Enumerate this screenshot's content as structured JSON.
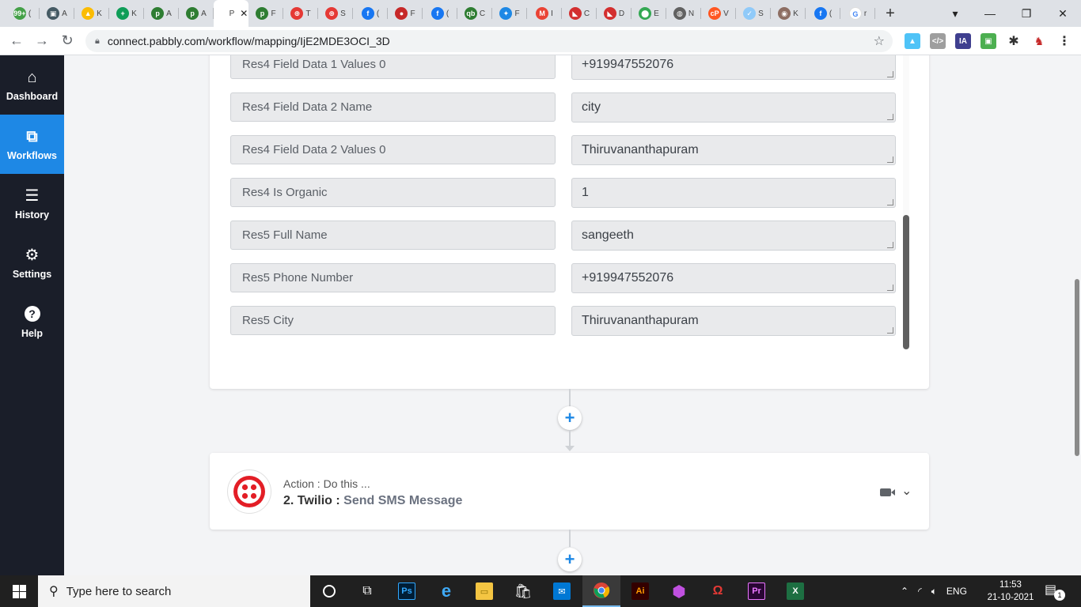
{
  "browser": {
    "tabs": [
      {
        "label": "(",
        "color": "#43a047",
        "glyph": "99+"
      },
      {
        "label": "A",
        "color": "#455a64",
        "glyph": "▣"
      },
      {
        "label": "K",
        "color": "#fbbc04",
        "glyph": "▲"
      },
      {
        "label": "K",
        "color": "#0f9d58",
        "glyph": "+"
      },
      {
        "label": "A",
        "color": "#2e7d32",
        "glyph": "p"
      },
      {
        "label": "A",
        "color": "#2e7d32",
        "glyph": "p"
      },
      {
        "label": "P",
        "color": "#ffffff",
        "glyph": "",
        "active": true
      },
      {
        "label": "F",
        "color": "#2e7d32",
        "glyph": "p"
      },
      {
        "label": "T",
        "color": "#e53935",
        "glyph": "⊕"
      },
      {
        "label": "S",
        "color": "#e53935",
        "glyph": "⊕"
      },
      {
        "label": "(",
        "color": "#1877f2",
        "glyph": "f"
      },
      {
        "label": "F",
        "color": "#c62828",
        "glyph": "●"
      },
      {
        "label": "(",
        "color": "#1877f2",
        "glyph": "f"
      },
      {
        "label": "C",
        "color": "#2e7d32",
        "glyph": "qb"
      },
      {
        "label": "F",
        "color": "#1e88e5",
        "glyph": "✦"
      },
      {
        "label": "I",
        "color": "#ea4335",
        "glyph": "M"
      },
      {
        "label": "C",
        "color": "#d32f2f",
        "glyph": "◣"
      },
      {
        "label": "D",
        "color": "#d32f2f",
        "glyph": "◣"
      },
      {
        "label": "E",
        "color": "#34a853",
        "glyph": "⬤"
      },
      {
        "label": "N",
        "color": "#616161",
        "glyph": "◍"
      },
      {
        "label": "V",
        "color": "#ff5722",
        "glyph": "cP"
      },
      {
        "label": "S",
        "color": "#90caf9",
        "glyph": "✓"
      },
      {
        "label": "K",
        "color": "#8d6e63",
        "glyph": "◉"
      },
      {
        "label": "(",
        "color": "#1877f2",
        "glyph": "f"
      },
      {
        "label": "r",
        "color": "#ffffff",
        "glyph": "G"
      }
    ],
    "active_tab_label": "P",
    "close_glyph": "✕",
    "new_tab_glyph": "+",
    "url": "connect.pabbly.com/workflow/mapping/IjE2MDE3OCI_3D"
  },
  "sidebar": {
    "items": [
      {
        "label": "Dashboard",
        "icon": "home-icon",
        "glyph": "⌂"
      },
      {
        "label": "Workflows",
        "icon": "workflow-icon",
        "glyph": "⧉",
        "active": true
      },
      {
        "label": "History",
        "icon": "history-list-icon",
        "glyph": "☰"
      },
      {
        "label": "Settings",
        "icon": "gear-icon",
        "glyph": "⚙"
      },
      {
        "label": "Help",
        "icon": "help-icon",
        "glyph": "?"
      }
    ]
  },
  "mapping": {
    "rows": [
      {
        "key": "Res4 Field Data 1 Values 0",
        "value": "+919947552076"
      },
      {
        "key": "Res4 Field Data 2 Name",
        "value": "city"
      },
      {
        "key": "Res4 Field Data 2 Values 0",
        "value": "Thiruvananthapuram"
      },
      {
        "key": "Res4 Is Organic",
        "value": "1"
      },
      {
        "key": "Res5 Full Name",
        "value": "sangeeth"
      },
      {
        "key": "Res5 Phone Number",
        "value": "+919947552076"
      },
      {
        "key": "Res5 City",
        "value": "Thiruvananthapuram"
      }
    ]
  },
  "action": {
    "subtitle": "Action : Do this ...",
    "step": "2. Twilio : ",
    "event": "Send SMS Message",
    "brand_color": "#e31e26"
  },
  "taskbar": {
    "search_placeholder": "Type here to search",
    "language": "ENG",
    "time": "11:53",
    "date": "21-10-2021",
    "notification_count": "1"
  }
}
